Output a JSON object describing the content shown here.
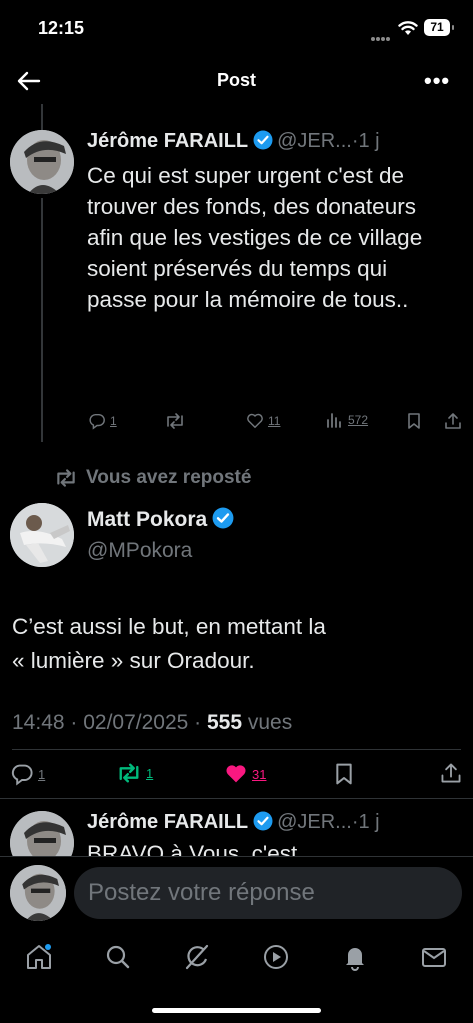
{
  "status_bar": {
    "time": "12:15",
    "battery": "71"
  },
  "header": {
    "title": "Post"
  },
  "parent_post": {
    "author_name": "Jérôme FARAILL",
    "handle": "@JER...",
    "separator": "·",
    "age": "1 j",
    "text": "Ce qui est super urgent c'est de trouver des fonds, des donateurs afin que les vestiges de ce village soient préservés du temps qui passe pour la mémoire de tous..",
    "replies": "1",
    "likes": "11",
    "views": "572"
  },
  "repost_indicator": {
    "text": "Vous avez reposté"
  },
  "main_post": {
    "author_name": "Matt Pokora",
    "handle": "@MPokora",
    "text_line1": "C’est aussi le but, en mettant la",
    "text_line2": "« lumière » sur Oradour.",
    "timestamp": "14:48 · 02/07/2025 · ",
    "views_count": "555",
    "views_label": " vues",
    "replies": "1",
    "reposts": "1",
    "likes": "31"
  },
  "reply_preview": {
    "author_name": "Jérôme FARAILL",
    "handle": "@JER...",
    "separator": "·",
    "age": "1 j",
    "text": "BRAVO à Vous, c'est"
  },
  "composer": {
    "placeholder": "Postez votre réponse"
  },
  "tabbar": {
    "items": [
      "home-icon",
      "search-icon",
      "grok-icon",
      "video-icon",
      "notifications-icon",
      "messages-icon"
    ]
  },
  "colors": {
    "verified": "#1d9bf0",
    "repost_active": "#00ba7c",
    "like_active": "#f91880"
  }
}
